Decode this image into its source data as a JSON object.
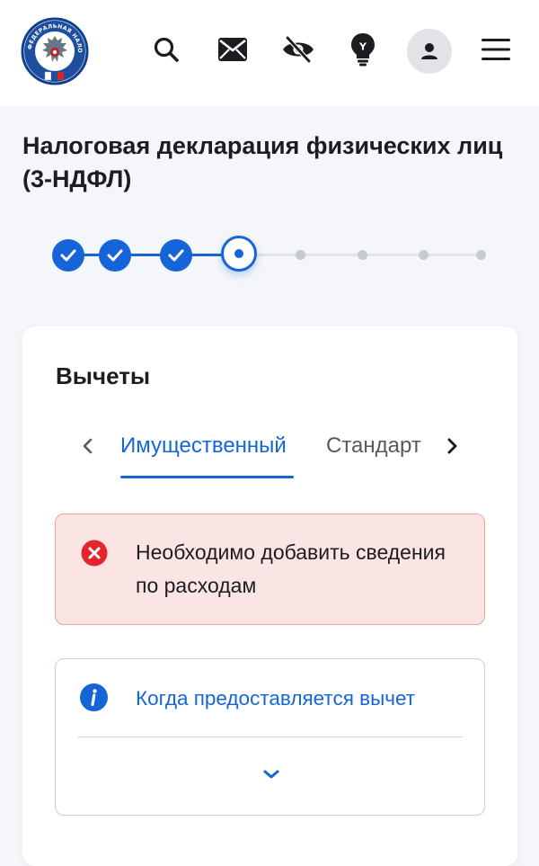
{
  "header": {
    "logo": "fns-emblem",
    "logo_text": "ФЕДЕРАЛЬНАЯ НАЛОГОВАЯ СЛУЖБА",
    "icons": [
      "search-icon",
      "mail-icon",
      "accessibility-eye-icon",
      "lightbulb-icon",
      "user-icon",
      "menu-icon"
    ],
    "lightbulb_letter": "Y"
  },
  "page": {
    "title": "Налоговая декларация физических лиц (3-НДФЛ)"
  },
  "stepper": {
    "total_steps": 8,
    "completed_steps": 3,
    "current_step": 4
  },
  "card": {
    "title": "Вычеты",
    "tabs": [
      {
        "label": "Имущественный",
        "active": true
      },
      {
        "label": "Стандартные",
        "active": false
      }
    ],
    "error_alert": {
      "message": "Необходимо добавить сведения по расходам"
    },
    "info_panel": {
      "link": "Когда предоставляется вычет"
    }
  },
  "colors": {
    "primary": "#1565d8",
    "error": "#e3262c",
    "error_bg": "#fbe4e4",
    "background": "#f4f6f9"
  }
}
